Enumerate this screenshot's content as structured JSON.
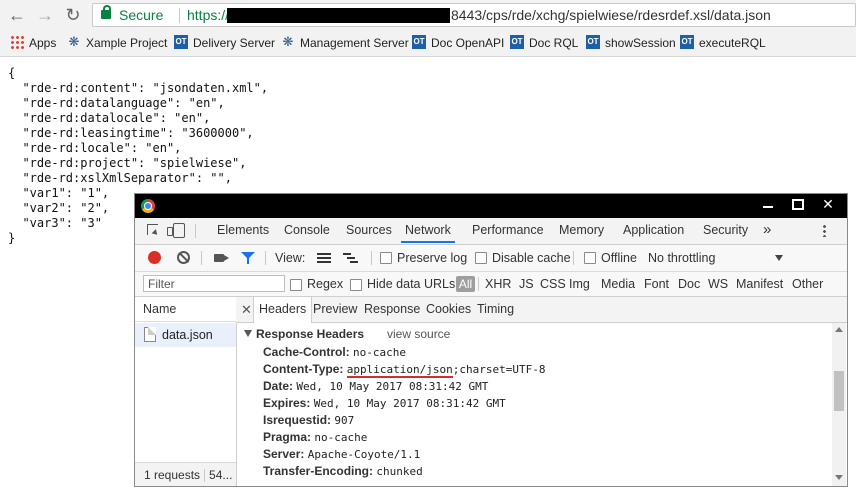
{
  "browser": {
    "secure_label": "Secure",
    "url_scheme": "https://",
    "url_rest": "8443/cps/rde/xchg/spielwiese/rdesrdef.xsl/data.json"
  },
  "bookmarks": [
    {
      "label": "Apps",
      "icon": "apps-grid-icon"
    },
    {
      "label": "Xample Project",
      "icon": "gear-icon"
    },
    {
      "label": "Delivery Server",
      "icon": "ot-icon"
    },
    {
      "label": "Management Server",
      "icon": "gear-icon"
    },
    {
      "label": "Doc OpenAPI",
      "icon": "ot-icon"
    },
    {
      "label": "Doc RQL",
      "icon": "ot-icon"
    },
    {
      "label": "showSession",
      "icon": "ot-icon"
    },
    {
      "label": "executeRQL",
      "icon": "ot-icon"
    }
  ],
  "page": {
    "json_lines": [
      "{",
      "  \"rde-rd:content\": \"jsondaten.xml\",",
      "  \"rde-rd:datalanguage\": \"en\",",
      "  \"rde-rd:datalocale\": \"en\",",
      "  \"rde-rd:leasingtime\": \"3600000\",",
      "  \"rde-rd:locale\": \"en\",",
      "  \"rde-rd:project\": \"spielwiese\",",
      "  \"rde-rd:xslXmlSeparator\": \"\",",
      "  \"var1\": \"1\",",
      "  \"var2\": \"2\",",
      "  \"var3\": \"3\"",
      "}"
    ]
  },
  "devtools": {
    "tabs": [
      "Elements",
      "Console",
      "Sources",
      "Network",
      "Performance",
      "Memory",
      "Application",
      "Security"
    ],
    "active_tab": "Network",
    "more_tabs": "»",
    "toolbar": {
      "view_label": "View:",
      "preserve_log": "Preserve log",
      "disable_cache": "Disable cache",
      "offline": "Offline",
      "throttling": "No throttling"
    },
    "filter": {
      "placeholder": "Filter",
      "regex": "Regex",
      "hide_data_urls": "Hide data URLs",
      "types": [
        "All",
        "XHR",
        "JS",
        "CSS",
        "Img",
        "Media",
        "Font",
        "Doc",
        "WS",
        "Manifest",
        "Other"
      ]
    },
    "requests": {
      "name_header": "Name",
      "items": [
        "data.json"
      ],
      "status": "1 requests",
      "status_extra": "54..."
    },
    "detail_tabs": [
      "Headers",
      "Preview",
      "Response",
      "Cookies",
      "Timing"
    ],
    "response_headers": {
      "title": "Response Headers",
      "view_source": "view source",
      "rows": [
        {
          "key": "Cache-Control:",
          "value": "no-cache"
        },
        {
          "key": "Content-Type:",
          "value_highlight": "application/json",
          "value_rest": ";charset=UTF-8"
        },
        {
          "key": "Date:",
          "value": "Wed, 10 May 2017 08:31:42 GMT"
        },
        {
          "key": "Expires:",
          "value": "Wed, 10 May 2017 08:31:42 GMT"
        },
        {
          "key": "Isrequestid:",
          "value": "907"
        },
        {
          "key": "Pragma:",
          "value": "no-cache"
        },
        {
          "key": "Server:",
          "value": "Apache-Coyote/1.1"
        },
        {
          "key": "Transfer-Encoding:",
          "value": "chunked"
        }
      ]
    }
  }
}
